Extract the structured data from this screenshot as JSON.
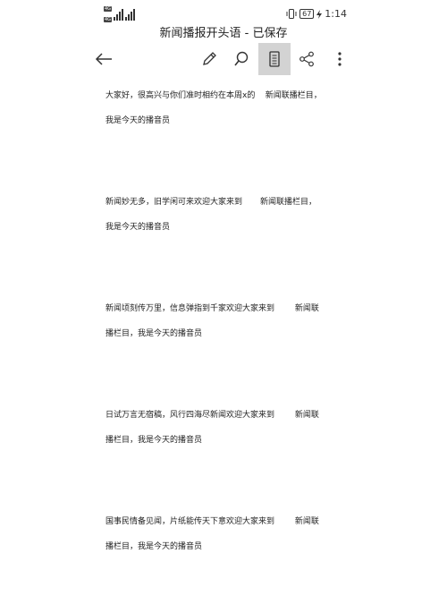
{
  "status_bar": {
    "sim1": "4G",
    "sim2": "4G",
    "battery": "67",
    "time": "1:14"
  },
  "title_bar": {
    "title": "新闻播报开头语 - 已保存"
  },
  "toolbar": {
    "icons": [
      "back-arrow-icon",
      "pen-edit-icon",
      "search-icon",
      "document-view-icon",
      "share-icon",
      "more-vertical-icon"
    ]
  },
  "paragraphs": [
    {
      "line1": "大家好，很高兴与你们准时相约在本周x的    新闻联播栏目，",
      "line2": "我是今天的播音员"
    },
    {
      "line1": "新闻妙无多，旧学闲可来欢迎大家来到       新闻联播栏目，",
      "line2": "我是今天的播音员"
    },
    {
      "line1": "新闻顷刻传万里，信息弹指到千家欢迎大家来到        新闻联",
      "line2": "播栏目，我是今天的播音员"
    },
    {
      "line1": "日试万言无宿稿，风行四海尽新闻欢迎大家来到        新闻联",
      "line2": "播栏目，我是今天的播音员"
    },
    {
      "line1": "国事民情备见闻，片纸能传天下意欢迎大家来到        新闻联",
      "line2": "播栏目，我是今天的播音员"
    }
  ]
}
